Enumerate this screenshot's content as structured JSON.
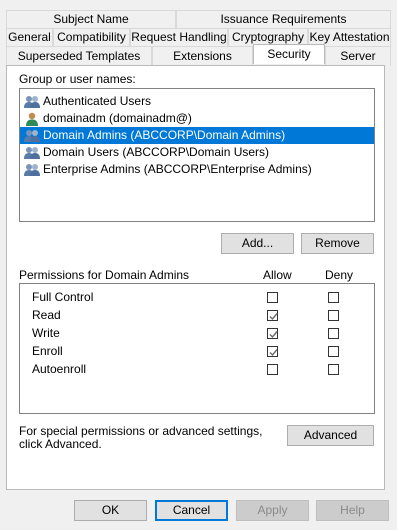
{
  "tabs_row1": [
    "Subject Name",
    "Issuance Requirements"
  ],
  "tabs_row2": [
    "General",
    "Compatibility",
    "Request Handling",
    "Cryptography",
    "Key Attestation"
  ],
  "tabs_row3": [
    "Superseded Templates",
    "Extensions",
    "Security",
    "Server"
  ],
  "active_tab": "Security",
  "group_label": "Group or user names:",
  "users": [
    {
      "name": "Authenticated Users",
      "icon": "group-icon",
      "selected": false
    },
    {
      "name": "domainadm (domainadm@)",
      "icon": "user-icon",
      "selected": false
    },
    {
      "name": "Domain Admins (ABCCORP\\Domain Admins)",
      "icon": "group-icon",
      "selected": true
    },
    {
      "name": "Domain Users (ABCCORP\\Domain Users)",
      "icon": "group-icon",
      "selected": false
    },
    {
      "name": "Enterprise Admins (ABCCORP\\Enterprise Admins)",
      "icon": "group-icon",
      "selected": false
    }
  ],
  "add_button": "Add...",
  "remove_button": "Remove",
  "permissions_label": "Permissions for Domain Admins",
  "allow_header": "Allow",
  "deny_header": "Deny",
  "permissions": [
    {
      "name": "Full Control",
      "allow": false,
      "deny": false
    },
    {
      "name": "Read",
      "allow": true,
      "deny": false
    },
    {
      "name": "Write",
      "allow": true,
      "deny": false
    },
    {
      "name": "Enroll",
      "allow": true,
      "deny": false
    },
    {
      "name": "Autoenroll",
      "allow": false,
      "deny": false
    }
  ],
  "special_text": "For special permissions or advanced settings, click Advanced.",
  "advanced_button": "Advanced",
  "footer": {
    "ok": "OK",
    "cancel": "Cancel",
    "apply": "Apply",
    "help": "Help"
  },
  "colors": {
    "selection": "#0078d7",
    "panel": "#ffffff",
    "window": "#f0f0f0",
    "check_disabled": "#6a6a6a"
  }
}
